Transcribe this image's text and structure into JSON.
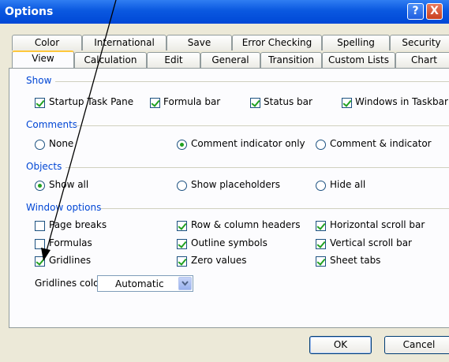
{
  "window": {
    "title": "Options",
    "help_label": "?",
    "close_label": "X"
  },
  "tabs_row1": [
    "Color",
    "International",
    "Save",
    "Error Checking",
    "Spelling",
    "Security"
  ],
  "tabs_row2": [
    "View",
    "Calculation",
    "Edit",
    "General",
    "Transition",
    "Custom Lists",
    "Chart"
  ],
  "active_tab": "View",
  "groups": {
    "show": "Show",
    "comments": "Comments",
    "objects": "Objects",
    "window_options": "Window options"
  },
  "show_options": [
    {
      "label": "Startup Task Pane",
      "checked": true
    },
    {
      "label": "Formula bar",
      "checked": true
    },
    {
      "label": "Status bar",
      "checked": true
    },
    {
      "label": "Windows in Taskbar",
      "checked": true
    }
  ],
  "comments_options": [
    {
      "label": "None",
      "selected": false
    },
    {
      "label": "Comment indicator only",
      "selected": true
    },
    {
      "label": "Comment & indicator",
      "selected": false
    }
  ],
  "objects_options": [
    {
      "label": "Show all",
      "selected": true
    },
    {
      "label": "Show placeholders",
      "selected": false
    },
    {
      "label": "Hide all",
      "selected": false
    }
  ],
  "window_options": {
    "page_breaks": {
      "label": "Page breaks",
      "checked": false
    },
    "formulas": {
      "label": "Formulas",
      "checked": false
    },
    "gridlines": {
      "label": "Gridlines",
      "checked": true
    },
    "row_column_headers": {
      "label": "Row & column headers",
      "checked": true
    },
    "outline_symbols": {
      "label": "Outline symbols",
      "checked": true
    },
    "zero_values": {
      "label": "Zero values",
      "checked": true
    },
    "horizontal_scroll_bar": {
      "label": "Horizontal scroll bar",
      "checked": true
    },
    "vertical_scroll_bar": {
      "label": "Vertical scroll bar",
      "checked": true
    },
    "sheet_tabs": {
      "label": "Sheet tabs",
      "checked": true
    }
  },
  "gridlines_color": {
    "label": "Gridlines color:",
    "value": "Automatic"
  },
  "buttons": {
    "ok": "OK",
    "cancel": "Cancel"
  },
  "colors": {
    "title_bar": "#0a58e0",
    "group_label": "#0046d5",
    "check": "#21a121",
    "arrow": "#000000"
  }
}
